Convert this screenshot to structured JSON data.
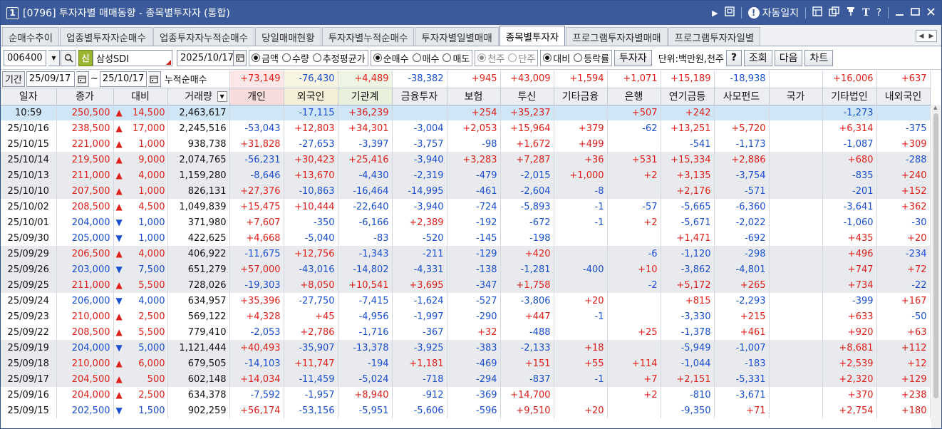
{
  "titlebar": {
    "number": "1",
    "title": "[0796] 투자자별 매매동향 - 종목별투자자 (통합)",
    "auto_connect": "자동일지",
    "t_label": "T",
    "help": "?"
  },
  "tabs": [
    {
      "label": "순매수추이",
      "active": false
    },
    {
      "label": "업종별투자자순매수",
      "active": false
    },
    {
      "label": "업종투자자누적순매수",
      "active": false
    },
    {
      "label": "당일매매현황",
      "active": false
    },
    {
      "label": "투자자별누적순매수",
      "active": false
    },
    {
      "label": "투자자별일별매매",
      "active": false
    },
    {
      "label": "종목별투자자",
      "active": true
    },
    {
      "label": "프로그램투자자별매매",
      "active": false
    },
    {
      "label": "프로그램투자자일별",
      "active": false
    }
  ],
  "controls": {
    "code": "006400",
    "badge": "신",
    "stock_name": "삼성SDI",
    "date": "2025/10/17",
    "opt1": [
      "금액",
      "수량",
      "추정평균가"
    ],
    "opt2": [
      "순매수",
      "매수",
      "매도"
    ],
    "opt3": [
      "천주",
      "단주"
    ],
    "opt4": [
      "대비",
      "등락률"
    ],
    "investor_btn": "투자자",
    "unit": "단위:백만원,천주",
    "help_btn": "?",
    "query_btn": "조회",
    "next_btn": "다음",
    "chart_btn": "차트"
  },
  "period": {
    "label": "기간",
    "from": "25/09/17",
    "tilde": "~",
    "to": "25/10/17",
    "cum_label": "누적순매수"
  },
  "summary": [
    "+73,149",
    "-76,430",
    "+4,489",
    "-38,382",
    "+945",
    "+43,009",
    "+1,594",
    "+1,071",
    "+15,189",
    "-18,938",
    "",
    "+16,006",
    "+637"
  ],
  "headers": [
    "일자",
    "종가",
    "대비",
    "거래량",
    "개인",
    "외국인",
    "기관계",
    "금융투자",
    "보험",
    "투신",
    "기타금융",
    "은행",
    "연기금등",
    "사모펀드",
    "국가",
    "기타법인",
    "내외국인"
  ],
  "rows": [
    [
      "10:59",
      "250,500",
      "up",
      "14,500",
      "2,463,617",
      "",
      "-17,115",
      "+36,239",
      "",
      "+254",
      "+35,237",
      "",
      "+507",
      "+242",
      "",
      "",
      "-1,273",
      ""
    ],
    [
      "25/10/16",
      "238,500",
      "up",
      "17,000",
      "2,245,516",
      "-53,043",
      "+12,803",
      "+34,301",
      "-3,004",
      "+2,053",
      "+15,964",
      "+379",
      "-62",
      "+13,251",
      "+5,720",
      "",
      "+6,314",
      "-375"
    ],
    [
      "25/10/15",
      "221,000",
      "up",
      "1,000",
      "938,738",
      "+31,828",
      "-27,653",
      "-3,397",
      "-3,757",
      "-98",
      "+1,672",
      "+499",
      "",
      "-541",
      "-1,173",
      "",
      "-1,087",
      "+309"
    ],
    [
      "25/10/14",
      "219,500",
      "up",
      "9,000",
      "2,074,765",
      "-56,231",
      "+30,423",
      "+25,416",
      "-3,940",
      "+3,283",
      "+7,287",
      "+36",
      "+531",
      "+15,334",
      "+2,886",
      "",
      "+680",
      "-288"
    ],
    [
      "25/10/13",
      "211,000",
      "up",
      "4,000",
      "1,159,280",
      "-8,646",
      "+13,670",
      "-4,430",
      "-2,319",
      "-479",
      "-2,015",
      "+1,000",
      "+2",
      "+3,135",
      "-3,754",
      "",
      "-835",
      "+240"
    ],
    [
      "25/10/10",
      "207,500",
      "up",
      "1,000",
      "826,131",
      "+27,376",
      "-10,863",
      "-16,464",
      "-14,995",
      "-461",
      "-2,604",
      "-8",
      "",
      "+2,176",
      "-571",
      "",
      "-201",
      "+152"
    ],
    [
      "25/10/02",
      "208,500",
      "up",
      "4,500",
      "1,049,839",
      "+15,475",
      "+10,444",
      "-22,640",
      "-3,940",
      "-724",
      "-5,893",
      "-1",
      "-57",
      "-5,665",
      "-6,360",
      "",
      "-3,641",
      "+362"
    ],
    [
      "25/10/01",
      "204,000",
      "dn",
      "1,000",
      "371,980",
      "+7,607",
      "-350",
      "-6,166",
      "+2,389",
      "-192",
      "-672",
      "-1",
      "+2",
      "-5,671",
      "-2,022",
      "",
      "-1,060",
      "-30"
    ],
    [
      "25/09/30",
      "205,000",
      "dn",
      "1,000",
      "422,625",
      "+4,668",
      "-5,040",
      "-83",
      "-520",
      "-145",
      "-198",
      "",
      "",
      "+1,471",
      "-692",
      "",
      "+435",
      "+20"
    ],
    [
      "25/09/29",
      "206,500",
      "up",
      "4,000",
      "406,922",
      "-11,675",
      "+12,756",
      "-1,343",
      "-211",
      "-129",
      "+420",
      "",
      "-6",
      "-1,120",
      "-298",
      "",
      "+496",
      "-234"
    ],
    [
      "25/09/26",
      "203,000",
      "dn",
      "7,500",
      "651,279",
      "+57,000",
      "-43,016",
      "-14,802",
      "-4,331",
      "-138",
      "-1,281",
      "-400",
      "+10",
      "-3,862",
      "-4,801",
      "",
      "+747",
      "+72"
    ],
    [
      "25/09/25",
      "211,000",
      "up",
      "5,500",
      "728,026",
      "-19,303",
      "+8,050",
      "+10,541",
      "+3,695",
      "-347",
      "+1,758",
      "",
      "-2",
      "+5,172",
      "+265",
      "",
      "+734",
      "-22"
    ],
    [
      "25/09/24",
      "206,000",
      "dn",
      "4,000",
      "634,957",
      "+35,396",
      "-27,750",
      "-7,415",
      "-1,624",
      "-527",
      "-3,806",
      "+20",
      "",
      "+815",
      "-2,293",
      "",
      "-399",
      "+167"
    ],
    [
      "25/09/23",
      "210,000",
      "up",
      "2,500",
      "569,122",
      "+4,328",
      "+45",
      "-4,956",
      "-1,997",
      "-290",
      "+447",
      "-1",
      "",
      "-3,330",
      "+215",
      "",
      "+633",
      "-50"
    ],
    [
      "25/09/22",
      "208,500",
      "up",
      "5,500",
      "779,410",
      "-2,053",
      "+2,786",
      "-1,716",
      "-367",
      "+32",
      "-488",
      "",
      "+25",
      "-1,378",
      "+461",
      "",
      "+920",
      "+63"
    ],
    [
      "25/09/19",
      "204,000",
      "dn",
      "5,000",
      "1,121,444",
      "+40,493",
      "-35,907",
      "-13,378",
      "-3,925",
      "-383",
      "-2,133",
      "+18",
      "",
      "-5,949",
      "-1,007",
      "",
      "+8,681",
      "+112"
    ],
    [
      "25/09/18",
      "210,000",
      "up",
      "6,000",
      "679,505",
      "-14,103",
      "+11,747",
      "-194",
      "+1,181",
      "-469",
      "+151",
      "+55",
      "+114",
      "-1,044",
      "-183",
      "",
      "+2,539",
      "+12"
    ],
    [
      "25/09/17",
      "204,500",
      "up",
      "500",
      "602,148",
      "+14,034",
      "-11,459",
      "-5,024",
      "-718",
      "-294",
      "-837",
      "-1",
      "+7",
      "+2,151",
      "-5,331",
      "",
      "+2,320",
      "+129"
    ],
    [
      "25/09/16",
      "204,000",
      "up",
      "2,500",
      "634,378",
      "-7,592",
      "-1,957",
      "+8,940",
      "-912",
      "-369",
      "+14,700",
      "",
      "+2",
      "-810",
      "-3,671",
      "",
      "+370",
      "+238"
    ],
    [
      "25/09/15",
      "202,500",
      "dn",
      "1,500",
      "902,259",
      "+56,174",
      "-53,156",
      "-5,951",
      "-5,606",
      "-596",
      "+9,510",
      "+20",
      "",
      "-9,350",
      "+71",
      "",
      "+2,754",
      "+180"
    ]
  ],
  "row_shading": [
    "cur",
    "w",
    "w",
    "gray",
    "gray",
    "gray",
    "w",
    "w",
    "w",
    "gray",
    "gray",
    "gray",
    "w",
    "w",
    "w",
    "gray",
    "gray",
    "gray",
    "w",
    "w"
  ]
}
